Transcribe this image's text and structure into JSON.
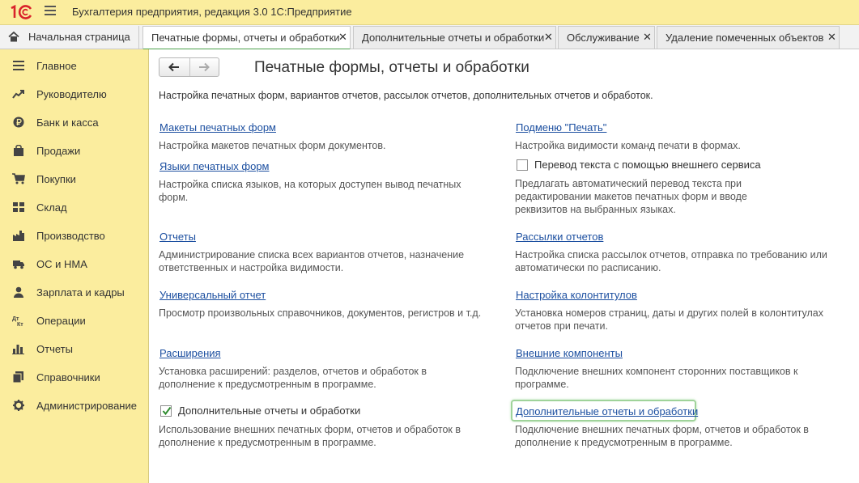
{
  "app": {
    "title": "Бухгалтерия предприятия, редакция 3.0 1С:Предприятие",
    "logo_text": "1С"
  },
  "tabs": [
    {
      "label": "Начальная страница",
      "close": ""
    },
    {
      "label": "Печатные формы, отчеты и обработки",
      "close": "✕"
    },
    {
      "label": "Дополнительные отчеты и обработки",
      "close": "✕"
    },
    {
      "label": "Обслуживание",
      "close": "✕"
    },
    {
      "label": "Удаление помеченных объектов",
      "close": "✕"
    }
  ],
  "sidebar": {
    "items": [
      {
        "label": "Главное",
        "icon": "menu-icon"
      },
      {
        "label": "Руководителю",
        "icon": "trend-icon"
      },
      {
        "label": "Банк и касса",
        "icon": "ruble-coin-icon"
      },
      {
        "label": "Продажи",
        "icon": "shopping-bag-icon"
      },
      {
        "label": "Покупки",
        "icon": "cart-icon"
      },
      {
        "label": "Склад",
        "icon": "warehouse-icon"
      },
      {
        "label": "Производство",
        "icon": "factory-icon"
      },
      {
        "label": "ОС и НМА",
        "icon": "truck-icon"
      },
      {
        "label": "Зарплата и кадры",
        "icon": "person-icon"
      },
      {
        "label": "Операции",
        "icon": "dt-kt-icon"
      },
      {
        "label": "Отчеты",
        "icon": "bar-chart-icon"
      },
      {
        "label": "Справочники",
        "icon": "books-icon"
      },
      {
        "label": "Администрирование",
        "icon": "gear-icon"
      }
    ]
  },
  "page": {
    "title": "Печатные формы, отчеты и обработки",
    "description": "Настройка печатных форм, вариантов отчетов, рассылок отчетов, дополнительных отчетов и обработок."
  },
  "left": {
    "print_layouts": {
      "link": "Макеты печатных форм",
      "desc": "Настройка макетов печатных форм документов."
    },
    "print_languages": {
      "link": "Языки печатных форм",
      "desc": "Настройка списка языков, на которых доступен вывод печатных форм."
    },
    "reports": {
      "link": "Отчеты",
      "desc": "Администрирование списка всех вариантов отчетов, назначение ответственных и настройка видимости."
    },
    "universal_report": {
      "link": "Универсальный отчет",
      "desc": "Просмотр произвольных справочников, документов, регистров и т.д."
    },
    "extensions": {
      "link": "Расширения",
      "desc": "Установка расширений: разделов, отчетов и обработок в дополнение к предусмотренным в программе."
    },
    "additional_reports": {
      "label": "Дополнительные отчеты и обработки",
      "checked": true,
      "desc": "Использование внешних печатных форм, отчетов и обработок в дополнение к предусмотренным в программе."
    }
  },
  "right": {
    "print_submenu": {
      "link": "Подменю \"Печать\"",
      "desc": "Настройка видимости команд печати в формах."
    },
    "translation": {
      "label": "Перевод текста с помощью внешнего сервиса",
      "checked": false,
      "desc": "Предлагать автоматический перевод текста при редактировании макетов печатных форм и вводе реквизитов на выбранных языках."
    },
    "report_mailings": {
      "link": "Рассылки отчетов",
      "desc": "Настройка списка рассылок отчетов, отправка по требованию или автоматически по расписанию."
    },
    "headers_footers": {
      "link": "Настройка колонтитулов",
      "desc": "Установка номеров страниц, даты и других полей в колонтитулах отчетов при печати."
    },
    "external_components": {
      "link": "Внешние компоненты",
      "desc": "Подключение внешних компонент сторонних поставщиков к программе."
    },
    "additional_reports_link": {
      "link": "Дополнительные отчеты и обработки",
      "desc": "Подключение внешних печатных форм, отчетов и обработок в дополнение к предусмотренным в программе."
    }
  }
}
